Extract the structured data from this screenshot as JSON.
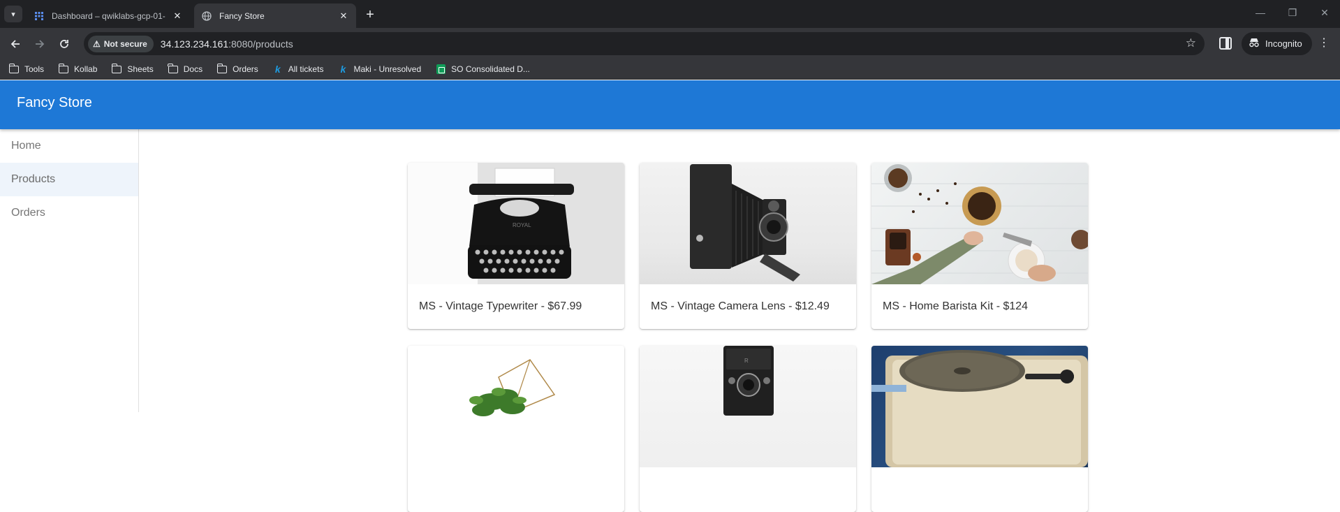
{
  "browser": {
    "tabs": [
      {
        "title": "Dashboard – qwiklabs-gcp-01-",
        "active": false
      },
      {
        "title": "Fancy Store",
        "active": true
      }
    ],
    "security_label": "Not secure",
    "url_host": "34.123.234.161",
    "url_path": ":8080/products",
    "incognito_label": "Incognito",
    "bookmarks": [
      {
        "label": "Tools",
        "icon": "folder-icon"
      },
      {
        "label": "Kollab",
        "icon": "folder-icon"
      },
      {
        "label": "Sheets",
        "icon": "folder-icon"
      },
      {
        "label": "Docs",
        "icon": "folder-icon"
      },
      {
        "label": "Orders",
        "icon": "folder-icon"
      },
      {
        "label": "All tickets",
        "icon": "k-icon"
      },
      {
        "label": "Maki - Unresolved",
        "icon": "k-icon"
      },
      {
        "label": "SO Consolidated D...",
        "icon": "sheets-icon"
      }
    ]
  },
  "app": {
    "title": "Fancy Store",
    "nav": [
      {
        "label": "Home",
        "selected": false
      },
      {
        "label": "Products",
        "selected": true
      },
      {
        "label": "Orders",
        "selected": false
      }
    ],
    "products": [
      {
        "label": "MS - Vintage Typewriter - $67.99",
        "image": "typewriter"
      },
      {
        "label": "MS - Vintage Camera Lens - $12.49",
        "image": "folding-camera"
      },
      {
        "label": "MS - Home Barista Kit - $124",
        "image": "coffee-pour-over"
      },
      {
        "label": "",
        "image": "terrarium-plant"
      },
      {
        "label": "",
        "image": "twin-lens-camera"
      },
      {
        "label": "",
        "image": "record-player"
      }
    ]
  },
  "colors": {
    "app_bar": "#1e78d6",
    "chrome_dark": "#202124",
    "chrome_toolbar": "#35363a",
    "nav_selected_bg": "#eef4fb"
  }
}
